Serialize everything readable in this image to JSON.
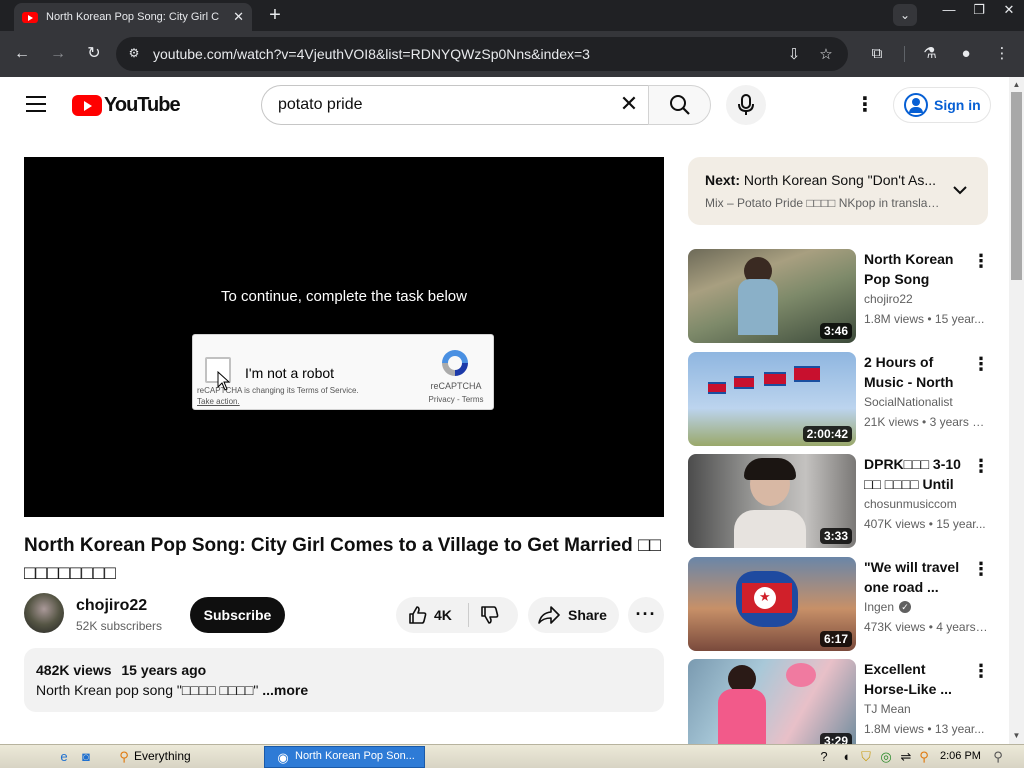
{
  "browser": {
    "tab_title": "North Korean Pop Song: City Girl C",
    "url": "youtube.com/watch?v=4VjeuthVOI8&list=RDNYQWzSp0Nns&index=3"
  },
  "masthead": {
    "logo_text": "YouTube",
    "search_query": "potato pride",
    "sign_in_label": "Sign in"
  },
  "player": {
    "message": "To continue, complete the task below",
    "captcha": {
      "checkbox_label": "I'm not a robot",
      "notice": "reCAPTCHA is changing its Terms of Service.",
      "notice_link": "Take action.",
      "brand": "reCAPTCHA",
      "legal": "Privacy - Terms"
    }
  },
  "video": {
    "title": "North Korean Pop Song: City Girl Comes to a Village to Get Married □□ □□□□□□□□",
    "channel_name": "chojiro22",
    "channel_subscribers": "52K subscribers",
    "subscribe_label": "Subscribe",
    "like_count": "4K",
    "share_label": "Share",
    "views": "482K views",
    "age": "15 years ago",
    "description": "North Krean pop song \"□□□□ □□□□\"",
    "more_label": "...more"
  },
  "playlist": {
    "next_prefix": "Next:",
    "next_title": "North Korean Song \"Don't As...",
    "mix_title": "Mix – Potato Pride □□□□ NKpop in translat..."
  },
  "recommendations": [
    {
      "title": "North Korean Pop Song \"□□...",
      "channel": "chojiro22",
      "views": "1.8M views",
      "age": "15 year...",
      "duration": "3:46",
      "verified": false
    },
    {
      "title": "2 Hours of Music - North ...",
      "channel": "SocialNationalist",
      "views": "21K views",
      "age": "3 years a...",
      "duration": "2:00:42",
      "verified": false
    },
    {
      "title": "DPRK□□□ 3-10 □□ □□□□ Until We ...",
      "channel": "chosunmusiccom",
      "views": "407K views",
      "age": "15 year...",
      "duration": "3:33",
      "verified": false
    },
    {
      "title": "\"We will travel one road ...",
      "channel": "Ingen",
      "views": "473K views",
      "age": "4 years ...",
      "duration": "6:17",
      "verified": true
    },
    {
      "title": "Excellent Horse-Like ...",
      "channel": "TJ Mean",
      "views": "1.8M views",
      "age": "13 year...",
      "duration": "3:29",
      "verified": false
    }
  ],
  "taskbar": {
    "everything_label": "Everything",
    "active_window": "North Korean Pop Son...",
    "clock": "2:06 PM"
  }
}
